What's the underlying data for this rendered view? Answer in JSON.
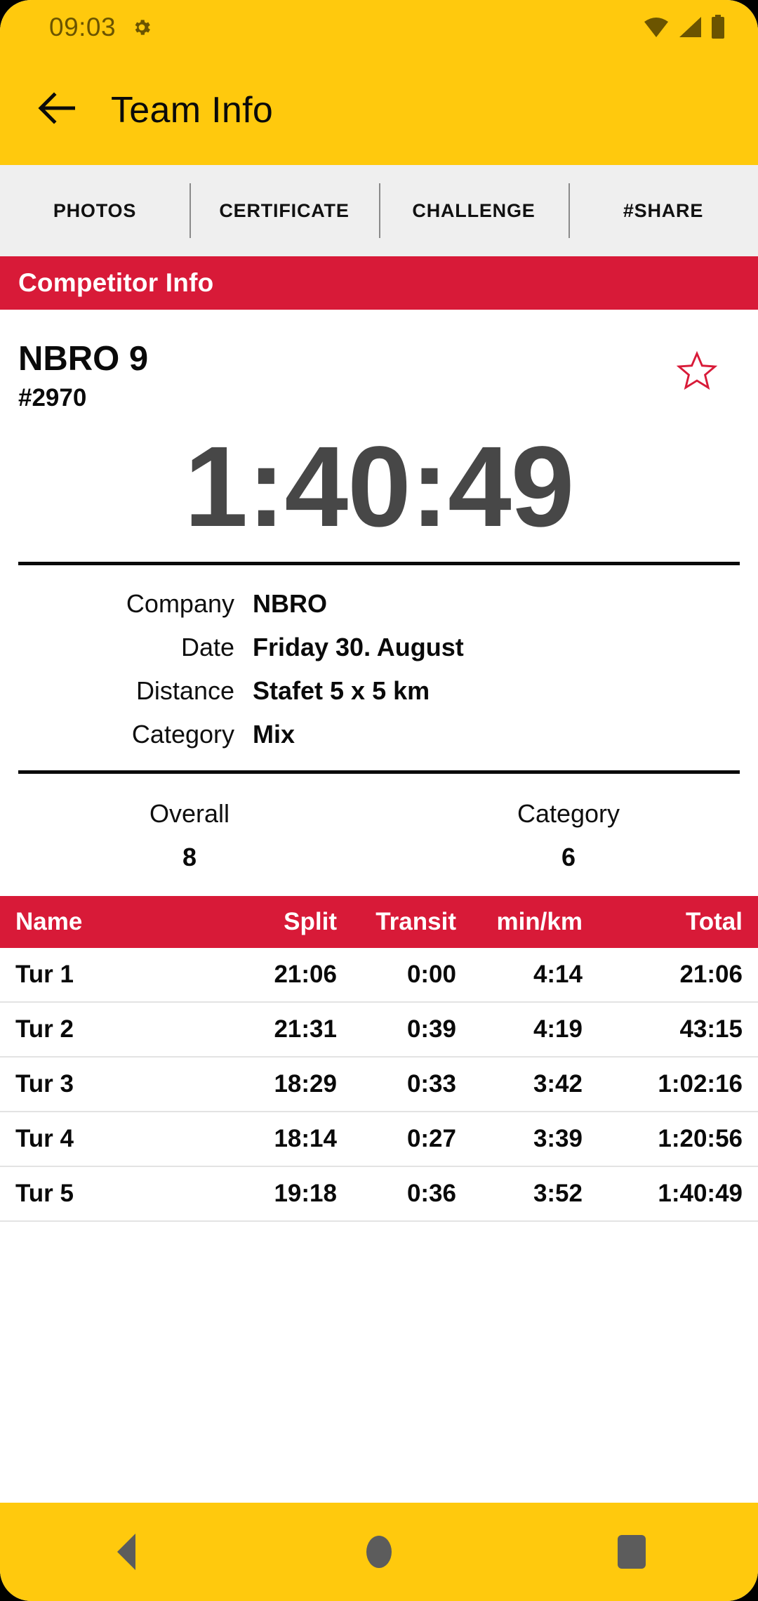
{
  "status_bar": {
    "time": "09:03",
    "gear_icon": "gear-icon",
    "wifi_icon": "wifi-icon",
    "signal_icon": "cellular-signal-icon",
    "battery_icon": "battery-icon"
  },
  "app_bar": {
    "back_icon": "arrow-left-icon",
    "title": "Team Info"
  },
  "tabs": [
    {
      "label": "PHOTOS"
    },
    {
      "label": "CERTIFICATE"
    },
    {
      "label": "CHALLENGE"
    },
    {
      "label": "#SHARE"
    }
  ],
  "section": {
    "title": "Competitor Info"
  },
  "competitor": {
    "name": "NBRO 9",
    "bib": "#2970",
    "favorite_icon": "star-outline-icon",
    "finish_time": "1:40:49"
  },
  "info": {
    "rows": [
      {
        "label": "Company",
        "value": "NBRO"
      },
      {
        "label": "Date",
        "value": "Friday 30. August"
      },
      {
        "label": "Distance",
        "value": "Stafet 5 x 5 km"
      },
      {
        "label": "Category",
        "value": "Mix"
      }
    ]
  },
  "ranks": [
    {
      "label": "Overall",
      "value": "8"
    },
    {
      "label": "Category",
      "value": "6"
    }
  ],
  "splits": {
    "headers": {
      "name": "Name",
      "split": "Split",
      "transit": "Transit",
      "pace": "min/km",
      "total": "Total"
    },
    "rows": [
      {
        "name": "Tur 1",
        "split": "21:06",
        "transit": "0:00",
        "pace": "4:14",
        "total": "21:06"
      },
      {
        "name": "Tur 2",
        "split": "21:31",
        "transit": "0:39",
        "pace": "4:19",
        "total": "43:15"
      },
      {
        "name": "Tur 3",
        "split": "18:29",
        "transit": "0:33",
        "pace": "3:42",
        "total": "1:02:16"
      },
      {
        "name": "Tur 4",
        "split": "18:14",
        "transit": "0:27",
        "pace": "3:39",
        "total": "1:20:56"
      },
      {
        "name": "Tur 5",
        "split": "19:18",
        "transit": "0:36",
        "pace": "3:52",
        "total": "1:40:49"
      }
    ]
  },
  "nav_bar": {
    "back_icon": "nav-back-triangle-icon",
    "home_icon": "nav-home-circle-icon",
    "recents_icon": "nav-recents-square-icon"
  },
  "colors": {
    "brand_yellow": "#FFC90D",
    "brand_red": "#D81A38",
    "tab_background": "#EFEFEF",
    "time_gray": "#474747"
  }
}
